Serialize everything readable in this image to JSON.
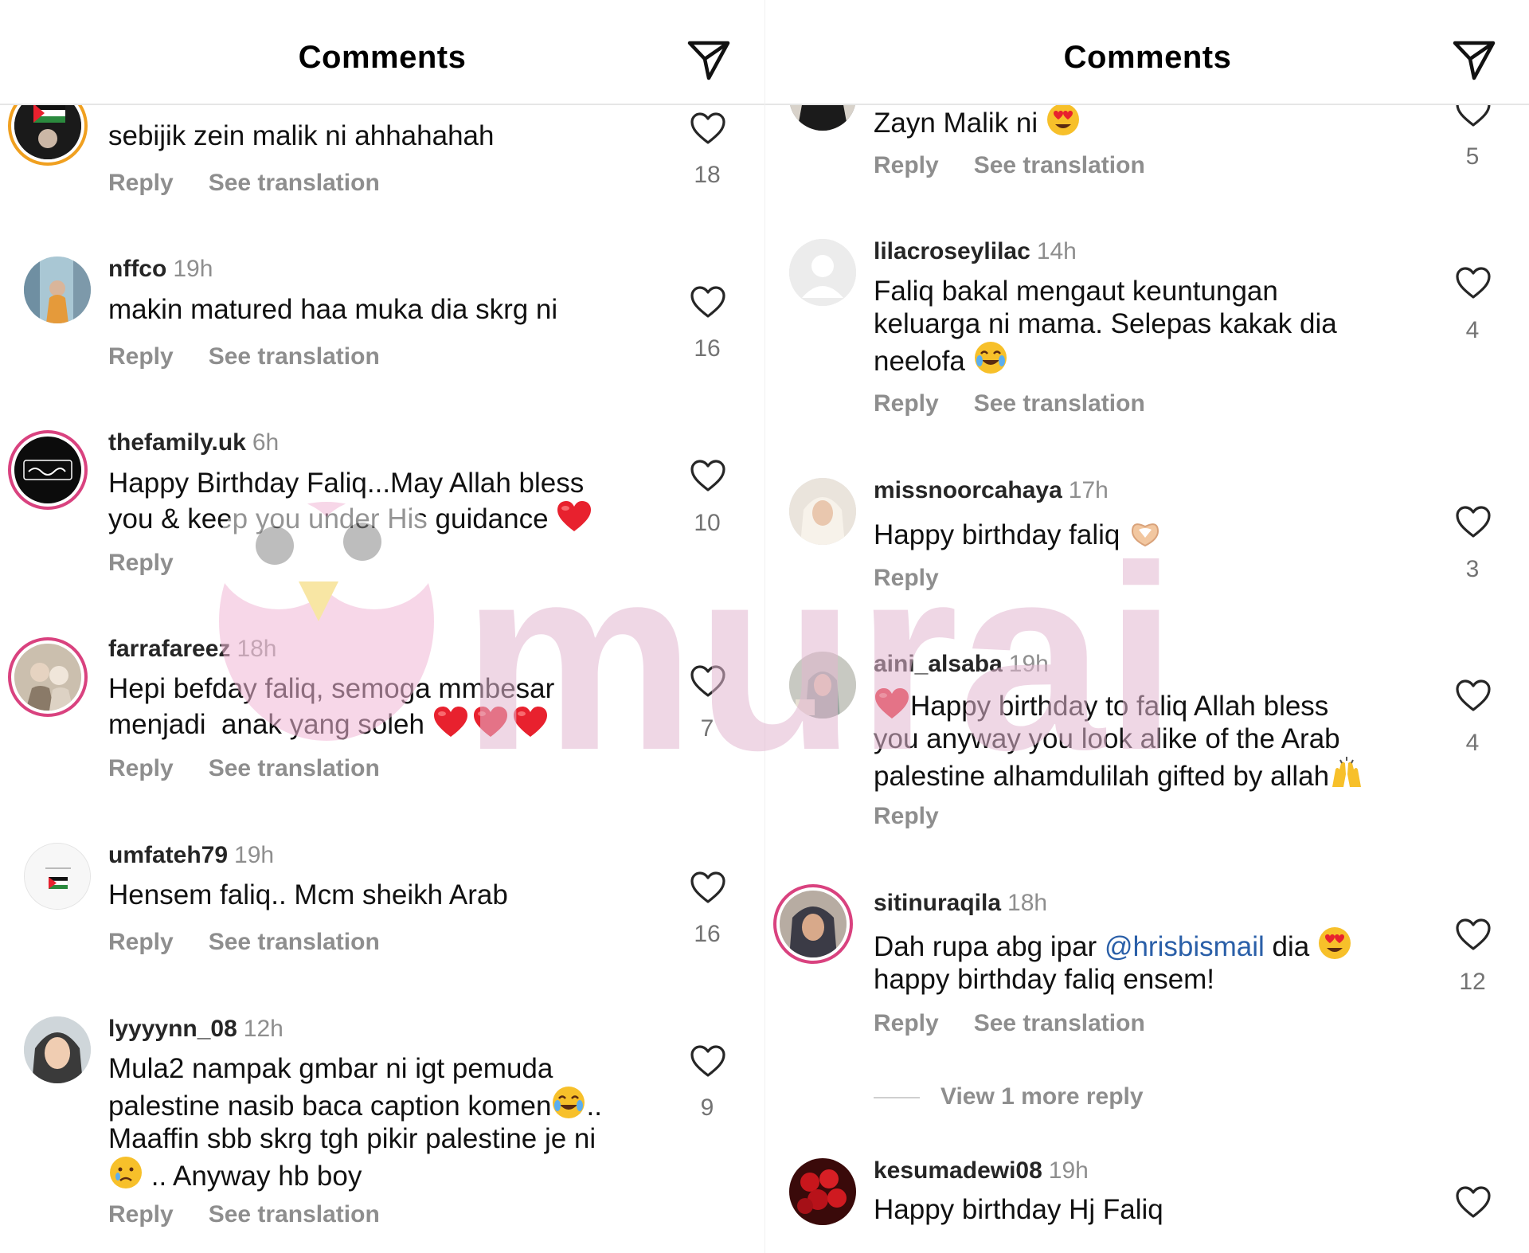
{
  "colors": {
    "heart_red": "#e8212e",
    "mention_blue": "#2a5fa8",
    "muted_gray": "#8e8e8e",
    "story_ring": "#d9427f"
  },
  "left": {
    "header": {
      "title": "Comments",
      "share_icon": "send-icon"
    },
    "comments": [
      {
        "username": "",
        "time": "",
        "text": "sebijik zein malik ni ahhahahah",
        "reply": "Reply",
        "translation": "See translation",
        "likes": "18"
      },
      {
        "username": "nffco",
        "time": "19h",
        "text": "makin matured haa muka dia skrg ni",
        "reply": "Reply",
        "translation": "See translation",
        "likes": "16"
      },
      {
        "username": "thefamily.uk",
        "time": "6h",
        "text_1": "Happy Birthday Faliq...May Allah bless",
        "text_2": "you & keep you under His guidance",
        "reply": "Reply",
        "likes": "10"
      },
      {
        "username": "farrafareez",
        "time": "18h",
        "text_1": "Hepi befday faliq, semoga mmbesar",
        "text_2": "menjadi  anak yang soleh",
        "reply": "Reply",
        "translation": "See translation",
        "likes": "7"
      },
      {
        "username": "umfateh79",
        "time": "19h",
        "text": "Hensem faliq.. Mcm sheikh Arab",
        "reply": "Reply",
        "translation": "See translation",
        "likes": "16"
      },
      {
        "username": "lyyyynn_08",
        "time": "12h",
        "text_1": "Mula2 nampak gmbar ni igt pemuda",
        "text_2": "palestine nasib baca caption komen",
        "text_2b": "..",
        "text_3": "Maaffin sbb skrg tgh pikir palestine je ni",
        "text_4": ".. Anyway hb boy",
        "reply": "Reply",
        "translation": "See translation",
        "likes": "9"
      }
    ]
  },
  "right": {
    "header": {
      "title": "Comments",
      "share_icon": "send-icon"
    },
    "comments": [
      {
        "username": "",
        "time": "",
        "text": "Zayn Malik ni",
        "reply": "Reply",
        "translation": "See translation",
        "likes": "5"
      },
      {
        "username": "lilacroseylilac",
        "time": "14h",
        "text_1": "Faliq bakal mengaut keuntungan",
        "text_2": "keluarga ni mama. Selepas kakak dia",
        "text_3": "neelofa",
        "reply": "Reply",
        "translation": "See translation",
        "likes": "4"
      },
      {
        "username": "missnoorcahaya",
        "time": "17h",
        "text": "Happy birthday faliq",
        "reply": "Reply",
        "likes": "3"
      },
      {
        "username": "aini_alsaba",
        "time": "19h",
        "text_1": "Happy birthday to faliq Allah bless",
        "text_2": "you anyway you look alike of the Arab",
        "text_3": "palestine alhamdulilah gifted by allah",
        "reply": "Reply",
        "likes": "4"
      },
      {
        "username": "sitinuraqila",
        "time": "18h",
        "text_1a": "Dah rupa abg ipar",
        "mention": "@hrisbismail",
        "text_1b": "dia",
        "text_2": "happy birthday faliq ensem!",
        "reply": "Reply",
        "translation": "See translation",
        "likes": "12",
        "view_more": "View 1 more reply"
      },
      {
        "username": "kesumadewi08",
        "time": "19h",
        "text": "Happy birthday Hj Faliq"
      }
    ]
  },
  "watermark": {
    "text": "murai"
  }
}
